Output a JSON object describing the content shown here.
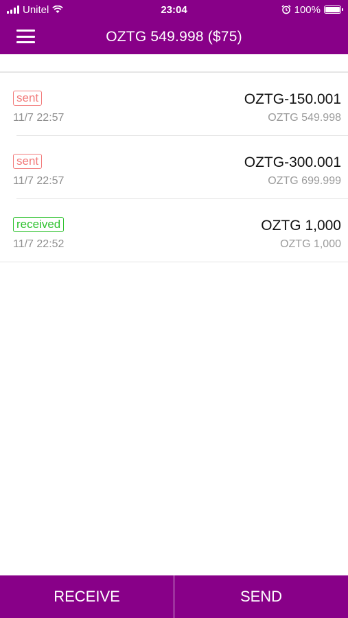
{
  "status_bar": {
    "carrier": "Unitel",
    "time": "23:04",
    "battery": "100%"
  },
  "header": {
    "title": "OZTG 549.998 ($75)"
  },
  "transactions": [
    {
      "type": "sent",
      "time": "11/7 22:57",
      "amount": "OZTG-150.001",
      "balance": "OZTG 549.998"
    },
    {
      "type": "sent",
      "time": "11/7 22:57",
      "amount": "OZTG-300.001",
      "balance": "OZTG 699.999"
    },
    {
      "type": "received",
      "time": "11/7 22:52",
      "amount": "OZTG 1,000",
      "balance": "OZTG 1,000"
    }
  ],
  "bottom_bar": {
    "receive_label": "RECEIVE",
    "send_label": "SEND"
  },
  "colors": {
    "brand": "#880088",
    "sent": "#f27a7a",
    "received": "#2ec22e"
  }
}
